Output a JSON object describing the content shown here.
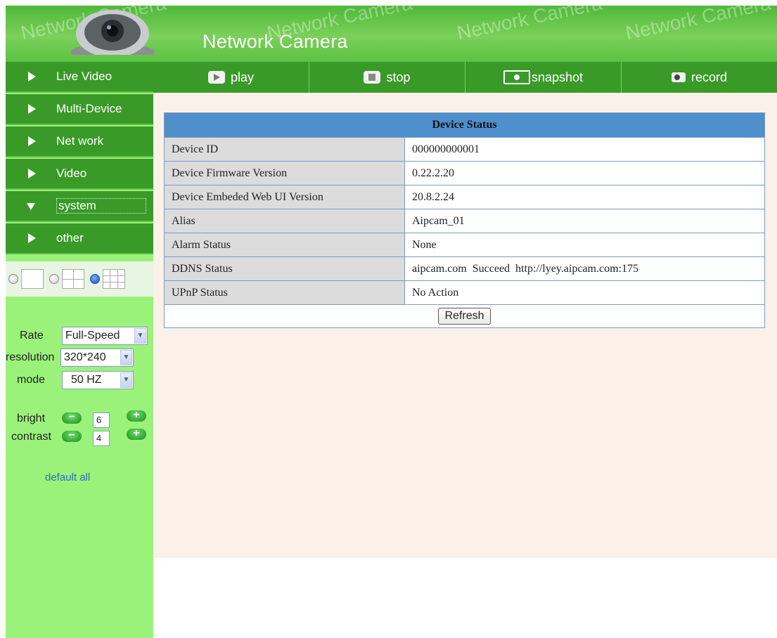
{
  "header": {
    "title": "Network Camera",
    "watermark": "Network Camera"
  },
  "sidebar": {
    "items": [
      {
        "label": "Live Video",
        "expanded": false
      },
      {
        "label": "Multi-Device",
        "expanded": false
      },
      {
        "label": "Net work",
        "expanded": false
      },
      {
        "label": "Video",
        "expanded": false
      },
      {
        "label": "system",
        "expanded": true
      },
      {
        "label": "other",
        "expanded": false
      }
    ],
    "layout_options": [
      {
        "name": "single-view",
        "selected": false
      },
      {
        "name": "quad-view",
        "selected": false
      },
      {
        "name": "nine-view",
        "selected": true
      }
    ],
    "controls": {
      "rate_label": "Rate",
      "rate_value": "Full-Speed",
      "resolution_label": "resolution",
      "resolution_value": "320*240",
      "mode_label": "mode",
      "mode_value": "50 HZ",
      "bright_label": "bright",
      "bright_value": "6",
      "contrast_label": "contrast",
      "contrast_value": "4",
      "minus": "−",
      "plus": "+",
      "default_all": "default all"
    }
  },
  "toolbar": {
    "play": "play",
    "stop": "stop",
    "snapshot": "snapshot",
    "record": "record"
  },
  "status_table": {
    "title": "Device Status",
    "rows": [
      {
        "key": "Device ID",
        "value": "000000000001"
      },
      {
        "key": "Device Firmware Version",
        "value": "0.22.2.20"
      },
      {
        "key": "Device Embeded Web UI Version",
        "value": "20.8.2.24"
      },
      {
        "key": "Alias",
        "value": "Aipcam_01"
      },
      {
        "key": "Alarm Status",
        "value": "None"
      },
      {
        "key": "DDNS Status",
        "value": "aipcam.com  Succeed  http://lyey.aipcam.com:175"
      },
      {
        "key": "UPnP Status",
        "value": "No Action"
      }
    ],
    "refresh_label": "Refresh"
  },
  "colors": {
    "menu_green": "#3a9a28",
    "sidebar_green": "#9bf27a",
    "table_header_blue": "#4e8fcc",
    "content_bg": "#fbf1e8"
  }
}
